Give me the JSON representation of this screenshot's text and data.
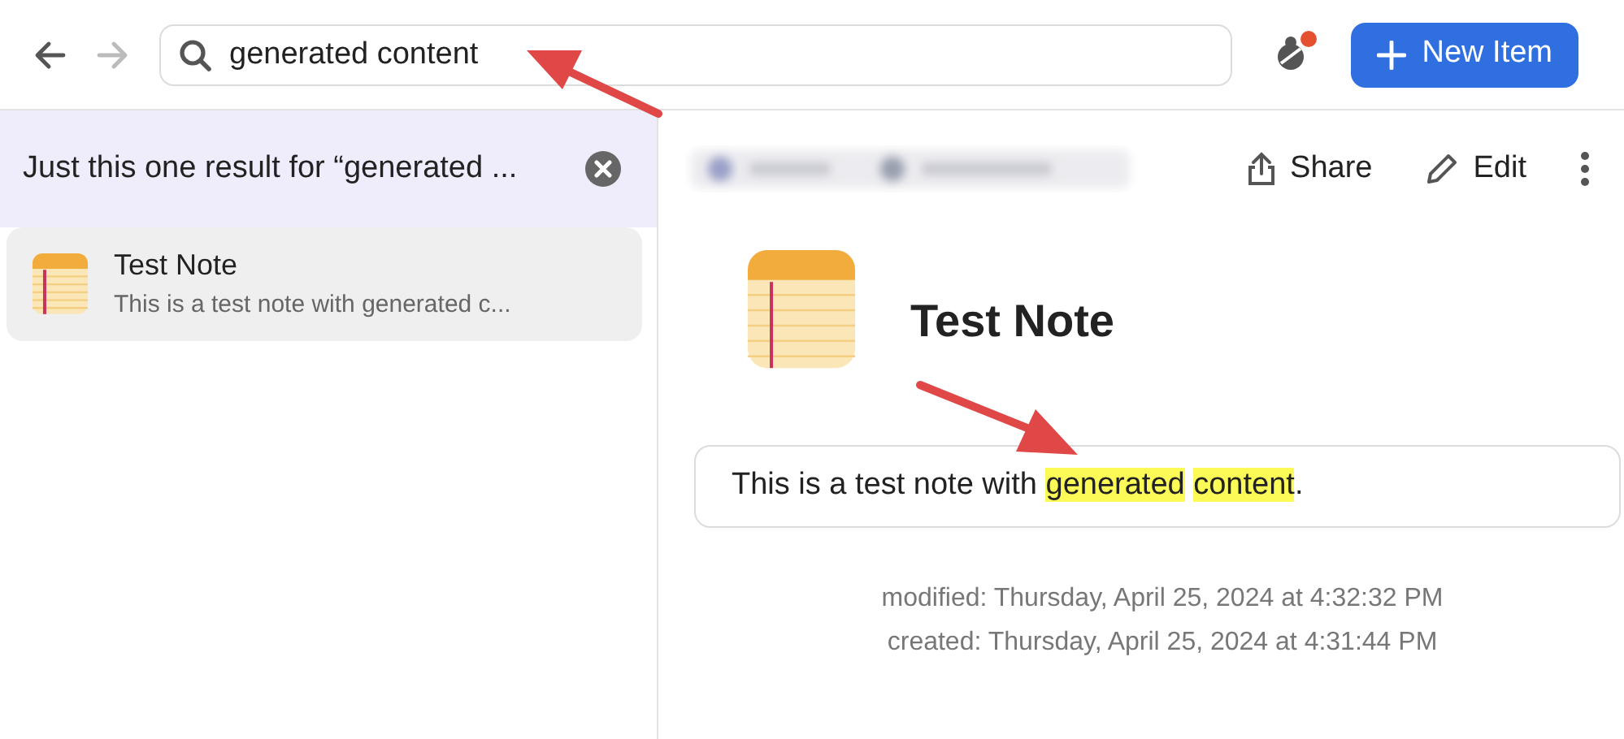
{
  "toolbar": {
    "back_enabled": true,
    "forward_enabled": false,
    "search": {
      "value": "generated content"
    },
    "notification_badge": true,
    "new_button": "New Item"
  },
  "results_banner": {
    "text": "Just this one result for “generated ..."
  },
  "results": [
    {
      "title": "Test Note",
      "snippet": "This is a test note with generated c...",
      "selected": true
    }
  ],
  "detail": {
    "actions": [
      "Share",
      "Edit"
    ],
    "title": "Test Note",
    "body": [
      {
        "text": "This is a test note with ",
        "highlighted": false
      },
      {
        "text": "generated",
        "highlighted": true
      },
      {
        "text": "content",
        "highlighted": true,
        "space_before": true
      },
      {
        "text": ".",
        "highlighted": false
      }
    ],
    "modified": "modified: Thursday, April 25, 2024 at 4:32:32 PM",
    "created": "created: Thursday, April 25, 2024 at 4:31:44 PM"
  }
}
